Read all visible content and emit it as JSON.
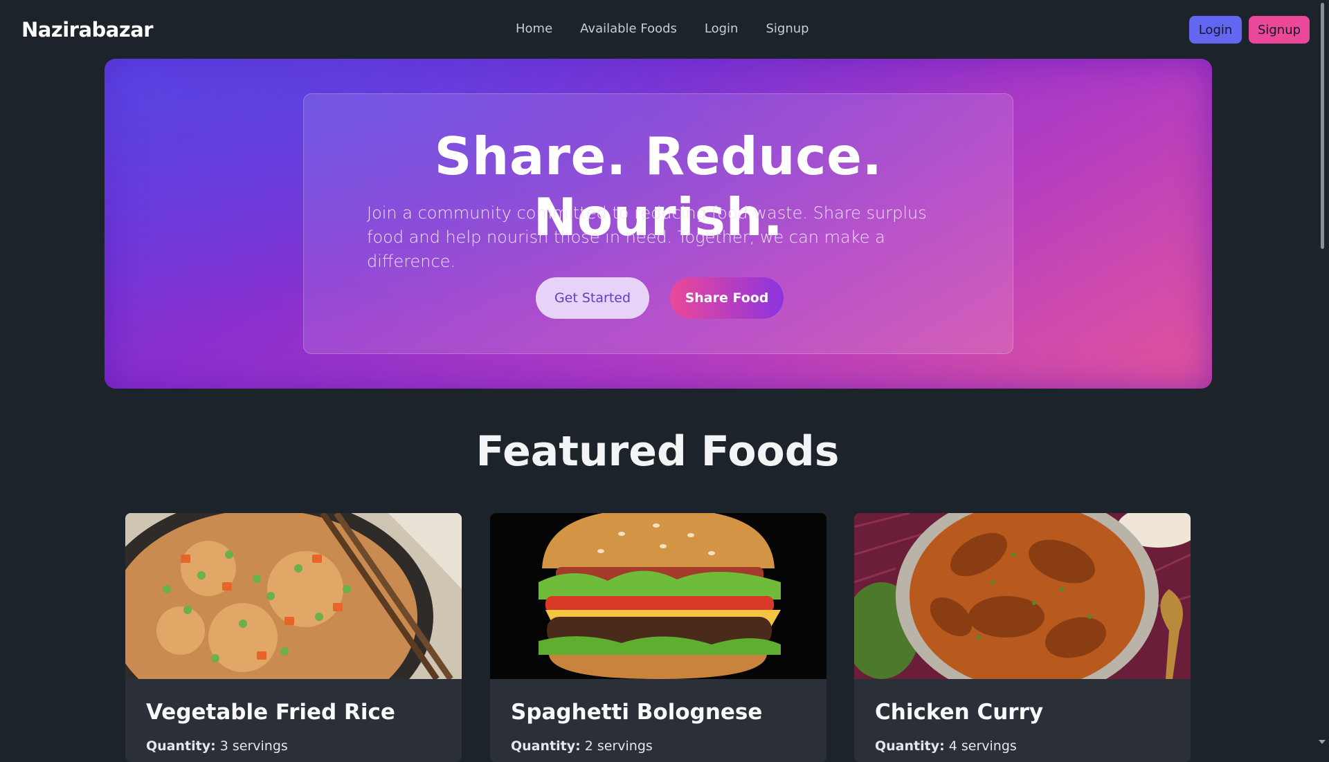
{
  "navbar": {
    "brand": "Nazirabazar",
    "links": [
      "Home",
      "Available Foods",
      "Login",
      "Signup"
    ],
    "login_button": "Login",
    "signup_button": "Signup"
  },
  "hero": {
    "title": "Share. Reduce. Nourish.",
    "subtitle": "Join a community committed to reducing food waste. Share surplus food and help nourish those in need. Together, we can make a difference.",
    "primary_button": "Get Started",
    "secondary_button": "Share Food"
  },
  "featured": {
    "title": "Featured Foods",
    "foods": [
      {
        "name": "Vegetable Fried Rice",
        "quantity_label": "Quantity:",
        "quantity_value": "3 servings",
        "image": "fried-rice"
      },
      {
        "name": "Spaghetti Bolognese",
        "quantity_label": "Quantity:",
        "quantity_value": "2 servings",
        "image": "burger"
      },
      {
        "name": "Chicken Curry",
        "quantity_label": "Quantity:",
        "quantity_value": "4 servings",
        "image": "chicken-curry"
      }
    ]
  },
  "colors": {
    "background": "#1d232a",
    "login": "#6366f1",
    "signup": "#ec4899",
    "hero_gradient_start": "#5b3fe0",
    "hero_gradient_end": "#e5559b"
  }
}
